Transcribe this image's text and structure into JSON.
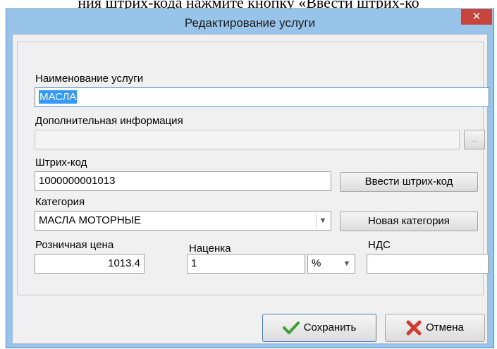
{
  "background_text": "ния штрих-кода нажмите кнопку «Ввести штрих-ко",
  "window": {
    "title": "Редактирование услуги",
    "close_symbol": "✕"
  },
  "form": {
    "name": {
      "label": "Наименование услуги",
      "value": "МАСЛА"
    },
    "extra": {
      "label": "Дополнительная информация",
      "value": "",
      "browse_label": "..."
    },
    "barcode": {
      "label": "Штрих-код",
      "value": "1000000001013",
      "button": "Ввести штрих-код"
    },
    "category": {
      "label": "Категория",
      "value": "МАСЛА МОТОРНЫЕ",
      "button": "Новая категория",
      "arrow_icon": "chevron-down-icon"
    },
    "price": {
      "label": "Розничная цена",
      "value": "1013.4"
    },
    "markup": {
      "label": "Наценка",
      "value": "1",
      "unit": "%"
    },
    "vat": {
      "label": "НДС",
      "value": ""
    }
  },
  "footer": {
    "save": "Сохранить",
    "cancel": "Отмена"
  },
  "colors": {
    "window_frame": "#99c4ea",
    "close_button": "#c7453c",
    "selection": "#3399ff",
    "save_icon": "#3aa13a",
    "cancel_icon": "#d33a2c"
  }
}
